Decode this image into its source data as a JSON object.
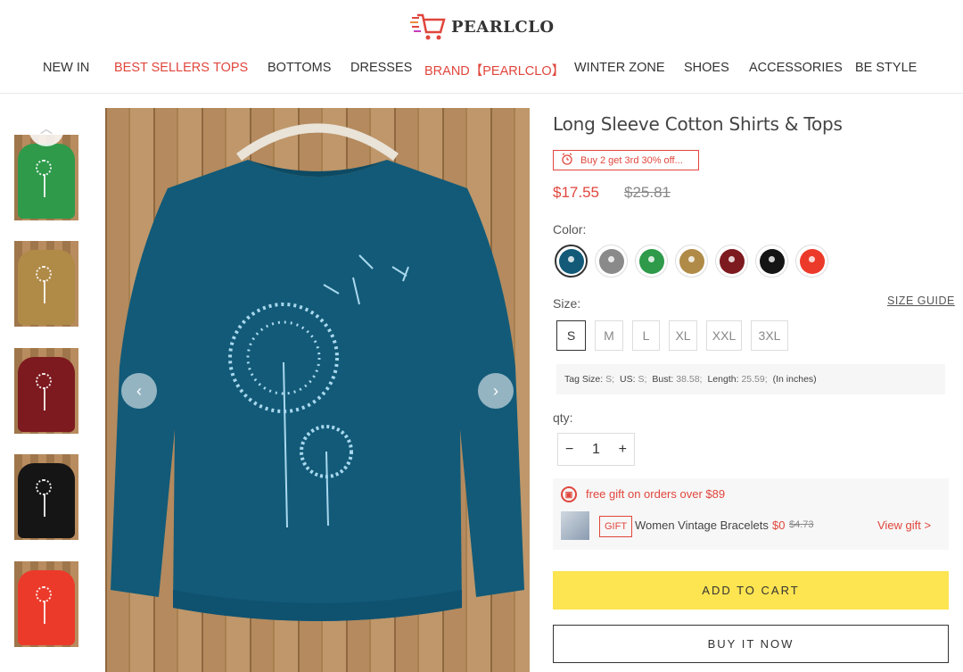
{
  "brand": {
    "name": "PEARLCLO"
  },
  "nav": [
    {
      "label": "NEW IN",
      "highlight": false
    },
    {
      "label": "BEST SELLERS",
      "highlight": true
    },
    {
      "label": "TOPS",
      "highlight": true
    },
    {
      "label": "BOTTOMS",
      "highlight": false
    },
    {
      "label": "DRESSES",
      "highlight": false
    },
    {
      "label": "BRAND【PEARLCLO】",
      "highlight": true
    },
    {
      "label": "WINTER ZONE",
      "highlight": false
    },
    {
      "label": "SHOES",
      "highlight": false
    },
    {
      "label": "ACCESSORIES",
      "highlight": false
    },
    {
      "label": "BE STYLE",
      "highlight": false
    }
  ],
  "gallery": {
    "up_icon": "chevron-up-icon",
    "prev_icon": "chevron-left-icon",
    "next_icon": "chevron-right-icon",
    "thumbnails": [
      {
        "color": "#2e9a4a"
      },
      {
        "color": "#b08a47"
      },
      {
        "color": "#7d1a1f"
      },
      {
        "color": "#151515"
      },
      {
        "color": "#ec3a2a"
      }
    ],
    "main_color": "#125a78"
  },
  "product": {
    "title": "Long Sleeve Cotton Shirts & Tops",
    "promo": "Buy 2 get 3rd 30% off...",
    "price": "$17.55",
    "old_price": "$25.81",
    "color_label": "Color:",
    "colors": [
      "#125a78",
      "#8a8a8a",
      "#2e9a4a",
      "#b08a47",
      "#7d1a1f",
      "#151515",
      "#ec3a2a"
    ],
    "selected_color_index": 0,
    "size_label": "Size:",
    "size_guide": "SIZE GUIDE",
    "sizes": [
      "S",
      "M",
      "L",
      "XL",
      "XXL",
      "3XL"
    ],
    "selected_size_index": 0,
    "size_info": {
      "tag_size_k": "Tag Size:",
      "tag_size_v": "S;",
      "us_k": "US:",
      "us_v": "S;",
      "bust_k": "Bust:",
      "bust_v": "38.58;",
      "length_k": "Length:",
      "length_v": "25.59;",
      "unit": "(In inches)"
    },
    "qty_label": "qty:",
    "qty_minus": "−",
    "qty_value": "1",
    "qty_plus": "+"
  },
  "gift": {
    "headline": "free gift on orders over $89",
    "tag": "GIFT",
    "name": "Women Vintage Bracelets",
    "price": "$0",
    "old_price": "$4.73",
    "view": "View gift >"
  },
  "actions": {
    "add_to_cart": "ADD TO CART",
    "buy_now": "BUY IT NOW"
  },
  "colors": {
    "accent": "#e0463c",
    "cart_button": "#fde451"
  }
}
